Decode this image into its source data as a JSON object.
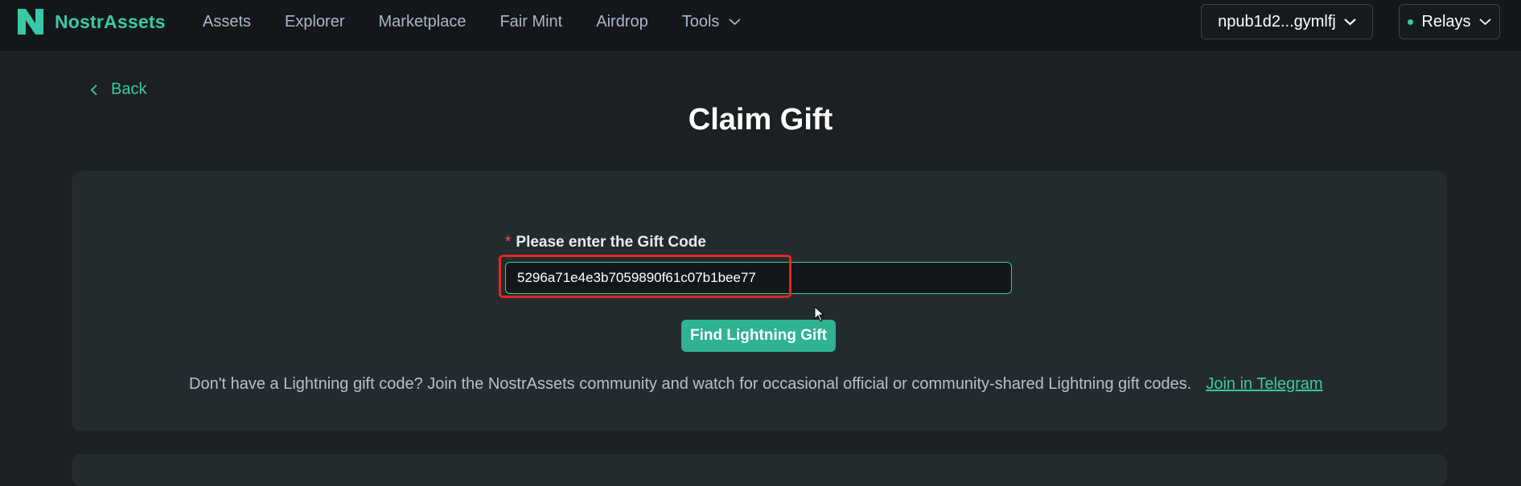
{
  "brand": {
    "name": "NostrAssets",
    "accent_color": "#38c9a6"
  },
  "nav": {
    "items": [
      {
        "label": "Assets"
      },
      {
        "label": "Explorer"
      },
      {
        "label": "Marketplace"
      },
      {
        "label": "Fair Mint"
      },
      {
        "label": "Airdrop"
      },
      {
        "label": "Tools",
        "has_dropdown": true
      }
    ]
  },
  "header": {
    "wallet_label": "npub1d2...gymlfj",
    "relays_label": "Relays"
  },
  "page": {
    "back_label": "Back",
    "title": "Claim Gift"
  },
  "form": {
    "required_mark": "*",
    "label": "Please enter the Gift Code",
    "gift_code_value": "5296a71e4e3b7059890f61c07b1bee77",
    "submit_label": "Find Lightning Gift"
  },
  "help": {
    "text": "Don't have a Lightning gift code? Join the NostrAssets community and watch for occasional official or community-shared Lightning gift codes.",
    "link_label": "Join in Telegram"
  }
}
